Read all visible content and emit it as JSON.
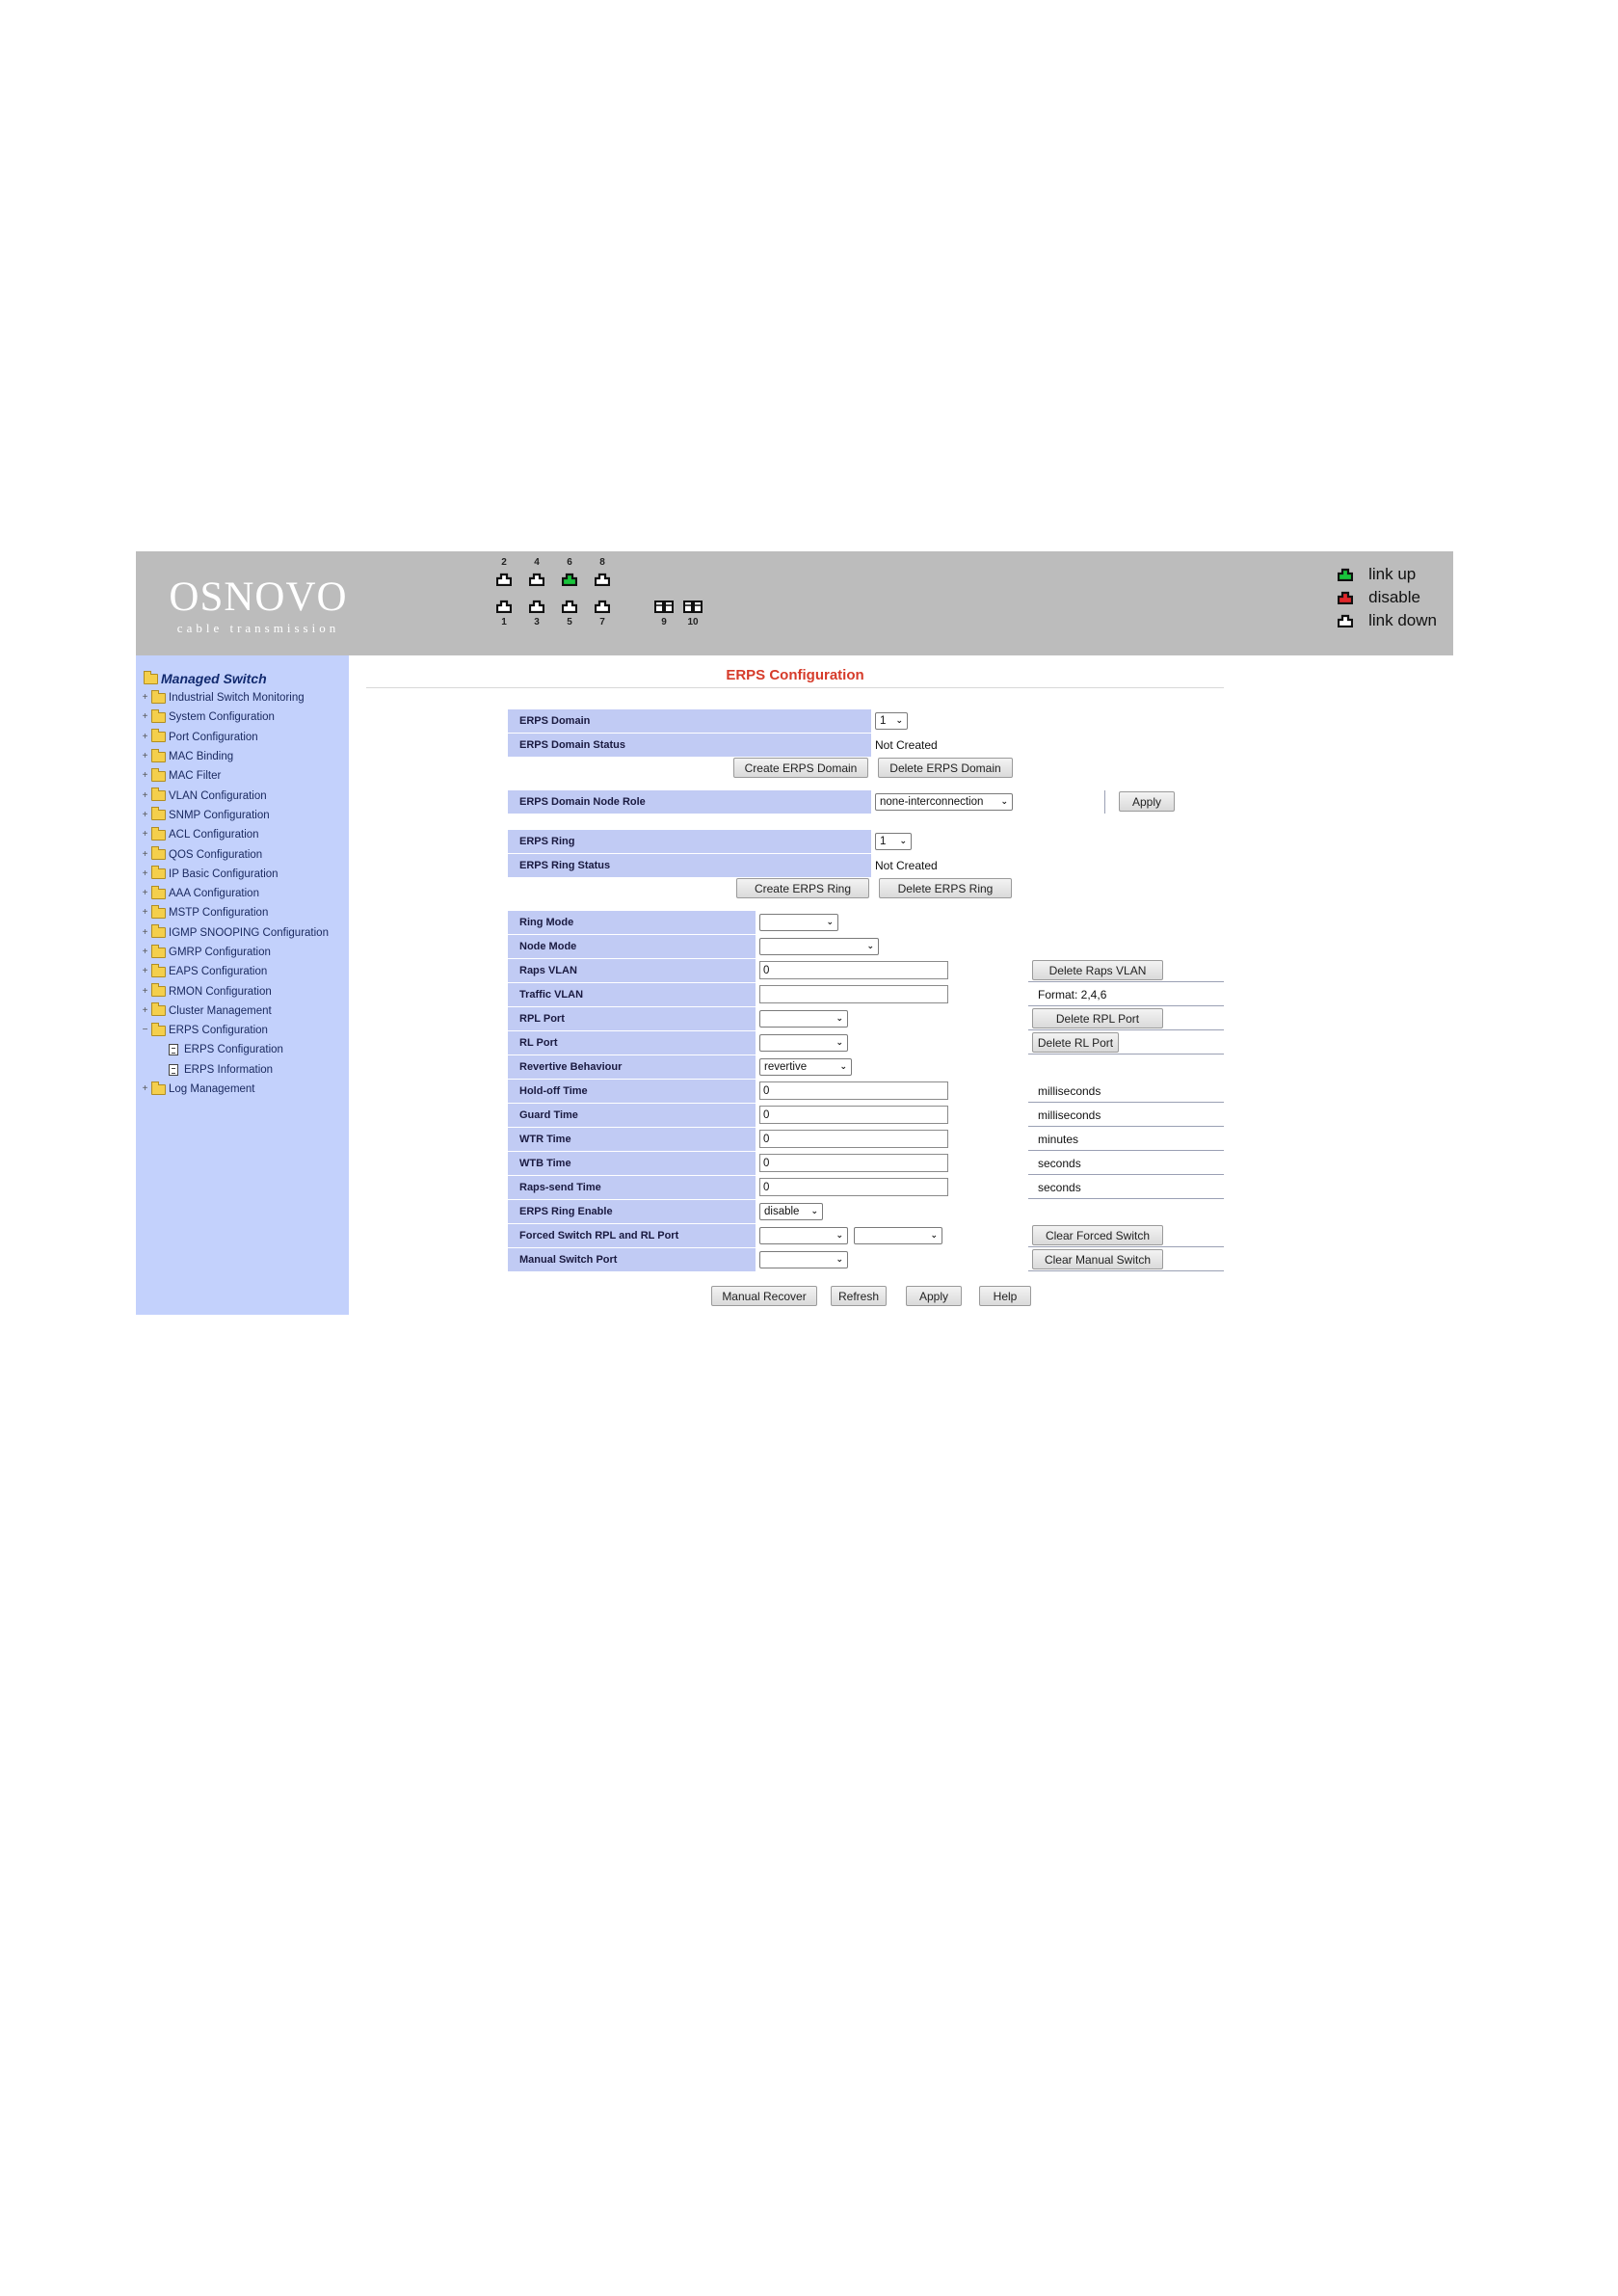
{
  "logo": {
    "text": "OSNOVO",
    "sub": "cable transmission"
  },
  "ports": {
    "top": [
      {
        "num": "2",
        "state": "down"
      },
      {
        "num": "4",
        "state": "down"
      },
      {
        "num": "6",
        "state": "up"
      },
      {
        "num": "8",
        "state": "down"
      }
    ],
    "bottom": [
      {
        "num": "1",
        "state": "down"
      },
      {
        "num": "3",
        "state": "down"
      },
      {
        "num": "5",
        "state": "down"
      },
      {
        "num": "7",
        "state": "down"
      }
    ],
    "sfp": [
      {
        "num": "9",
        "state": "down"
      },
      {
        "num": "10",
        "state": "down"
      }
    ]
  },
  "legend": [
    {
      "label": "link up",
      "color": "#19c43c"
    },
    {
      "label": "disable",
      "color": "#e0262a"
    },
    {
      "label": "link down",
      "color": "#222222"
    }
  ],
  "colors": {
    "header": "#bcbcbc",
    "sidebar": "#c3d1fc",
    "label_cell": "#c1cbf4",
    "title": "#d63b2a"
  },
  "sidebar": {
    "root": "Managed Switch",
    "items": [
      "Industrial Switch Monitoring",
      "System Configuration",
      "Port Configuration",
      "MAC Binding",
      "MAC Filter",
      "VLAN Configuration",
      "SNMP Configuration",
      "ACL Configuration",
      "QOS Configuration",
      "IP Basic Configuration",
      "AAA Configuration",
      "MSTP Configuration",
      "IGMP SNOOPING Configuration",
      "GMRP Configuration",
      "EAPS Configuration",
      "RMON Configuration",
      "Cluster Management",
      "ERPS Configuration"
    ],
    "children": [
      "ERPS Configuration",
      "ERPS Information"
    ],
    "last": "Log Management"
  },
  "page": {
    "title": "ERPS Configuration",
    "domain": {
      "label": "ERPS Domain",
      "value": "1"
    },
    "domain_status": {
      "label": "ERPS Domain Status",
      "value": "Not Created"
    },
    "create_domain": "Create ERPS Domain",
    "delete_domain": "Delete ERPS Domain",
    "node_role": {
      "label": "ERPS Domain Node Role",
      "value": "none-interconnection",
      "apply": "Apply"
    },
    "ring": {
      "label": "ERPS Ring",
      "value": "1"
    },
    "ring_status": {
      "label": "ERPS Ring Status",
      "value": "Not Created"
    },
    "create_ring": "Create ERPS Ring",
    "delete_ring": "Delete ERPS Ring",
    "ring_mode": {
      "label": "Ring Mode",
      "value": ""
    },
    "node_mode": {
      "label": "Node Mode",
      "value": ""
    },
    "raps_vlan": {
      "label": "Raps VLAN",
      "value": "0",
      "button": "Delete Raps VLAN"
    },
    "traffic_vlan": {
      "label": "Traffic VLAN",
      "value": "",
      "note": "Format: 2,4,6"
    },
    "rpl_port": {
      "label": "RPL Port",
      "value": "",
      "button": "Delete RPL Port"
    },
    "rl_port": {
      "label": "RL Port",
      "value": "",
      "button": "Delete RL Port"
    },
    "revertive": {
      "label": "Revertive Behaviour",
      "value": "revertive"
    },
    "holdoff": {
      "label": "Hold-off Time",
      "value": "0",
      "unit": "milliseconds"
    },
    "guard": {
      "label": "Guard Time",
      "value": "0",
      "unit": "milliseconds"
    },
    "wtr": {
      "label": "WTR Time",
      "value": "0",
      "unit": "minutes"
    },
    "wtb": {
      "label": "WTB Time",
      "value": "0",
      "unit": "seconds"
    },
    "raps_send": {
      "label": "Raps-send Time",
      "value": "0",
      "unit": "seconds"
    },
    "ring_enable": {
      "label": "ERPS Ring Enable",
      "value": "disable"
    },
    "forced_switch": {
      "label": "Forced Switch RPL and RL Port",
      "value1": "",
      "value2": "",
      "button": "Clear Forced Switch"
    },
    "manual_switch": {
      "label": "Manual Switch Port",
      "value": "",
      "button": "Clear Manual Switch"
    },
    "actions": {
      "manual_recover": "Manual Recover",
      "refresh": "Refresh",
      "apply": "Apply",
      "help": "Help"
    }
  }
}
